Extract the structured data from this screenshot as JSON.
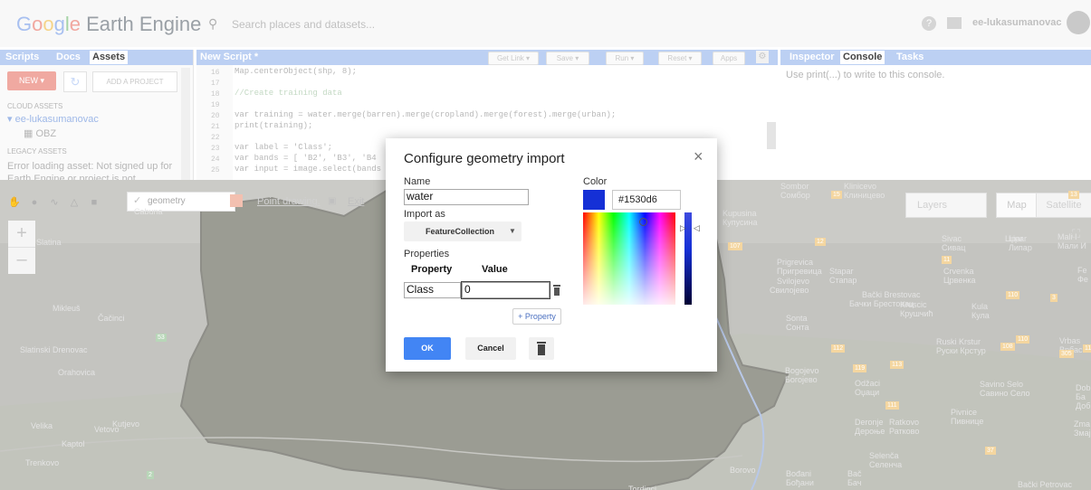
{
  "header": {
    "logo_google": [
      "G",
      "o",
      "o",
      "g",
      "l",
      "e"
    ],
    "logo_rest": " Earth Engine",
    "search_placeholder": "Search places and datasets...",
    "username": "ee-lukasumanovac"
  },
  "left_panel": {
    "tabs": [
      "Scripts",
      "Docs",
      "Assets"
    ],
    "active_tab": "Assets",
    "new_button": "NEW ▾",
    "add_project_button": "ADD A PROJECT",
    "cloud_assets_header": "CLOUD ASSETS",
    "project": "▾ ee-lukasumanovac",
    "asset": "OBZ",
    "legacy_assets_header": "LEGACY ASSETS",
    "error_text": "Error loading asset: Not signed up for Earth Engine or project is not"
  },
  "editor": {
    "title": "New Script *",
    "buttons": [
      "Get Link ▾",
      "Save ▾",
      "Run ▾",
      "Reset ▾",
      "Apps"
    ],
    "line_numbers": [
      "16",
      "17",
      "18",
      "19",
      "20",
      "21",
      "22",
      "23",
      "24",
      "25"
    ],
    "lines": [
      "Map.centerObject(shp, 8);",
      "",
      "//Create training data",
      "",
      "var training = water.merge(barren).merge(cropland).merge(forest).merge(urban);",
      "print(training);",
      "",
      "var label = 'Class';",
      "var bands = [ 'B2', 'B3', 'B4",
      "var input = image.select(bands"
    ]
  },
  "right_panel": {
    "tabs": [
      "Inspector",
      "Console",
      "Tasks"
    ],
    "active_tab": "Console",
    "console_message": "Use print(...) to write to this console."
  },
  "map": {
    "layer_name": "geometry",
    "point_drawing": "Point drawing.",
    "exit": "Exit",
    "layers_label": "Layers",
    "map_button": "Map",
    "satellite_button": "Satellite",
    "places": [
      "Sombor",
      "Сомбор",
      "Klinicevo",
      "Клиницево",
      "Kupusina",
      "Купусина",
      "Sivac",
      "Сивац",
      "Lipar",
      "Липар",
      "Mali I",
      "Мали И",
      "Prigrevica",
      "Пригревица",
      "Stapar",
      "Стапар",
      "Crvenka",
      "Црвенка",
      "Svilojevo",
      "Свилојево",
      "Bački Brestovac",
      "Бачки Брестовац",
      "Kruscic",
      "Крушчић",
      "Kula",
      "Кула",
      "Sonta",
      "Сонта",
      "Ruski Krstur",
      "Руски Крстур",
      "Vrbas",
      "Врбас",
      "Bogojevo",
      "Богојево",
      "Odžaci",
      "Оџаци",
      "Savino Selo",
      "Савино Село",
      "Deronje",
      "Дероње",
      "Ratkovo",
      "Ратково",
      "Pivnice",
      "Пивнице",
      "Selenča",
      "Селенча",
      "Bođani",
      "Бођани",
      "Bač",
      "Бач",
      "Bački Petrovac",
      "Borovo",
      "Tordinci",
      "Slatina",
      "Mikleuš",
      "Čačinci",
      "Slatinski Drenovac",
      "Orahovica",
      "Velika",
      "Kaptol",
      "Vetovo",
      "Kutjevo",
      "Trenkovo",
      "Cabuna",
      "Lipar",
      "Dobr",
      "Ба",
      "Добр",
      "Zma",
      "Змај",
      "Fe",
      "Фе"
    ],
    "road_badges": [
      "15",
      "12",
      "107",
      "11",
      "108",
      "110",
      "110",
      "111",
      "112",
      "113",
      "116",
      "119",
      "305",
      "3",
      "53",
      "2",
      "37",
      "13"
    ]
  },
  "dialog": {
    "title": "Configure geometry import",
    "name_label": "Name",
    "name_value": "water",
    "import_as_label": "Import as",
    "import_as_value": "FeatureCollection",
    "properties_label": "Properties",
    "property_header": "Property",
    "value_header": "Value",
    "property_name": "Class",
    "property_value": "0",
    "add_property_button": "+ Property",
    "ok_button": "OK",
    "cancel_button": "Cancel",
    "color_label": "Color",
    "color_hex": "#1530d6",
    "color": "#1530d6"
  }
}
